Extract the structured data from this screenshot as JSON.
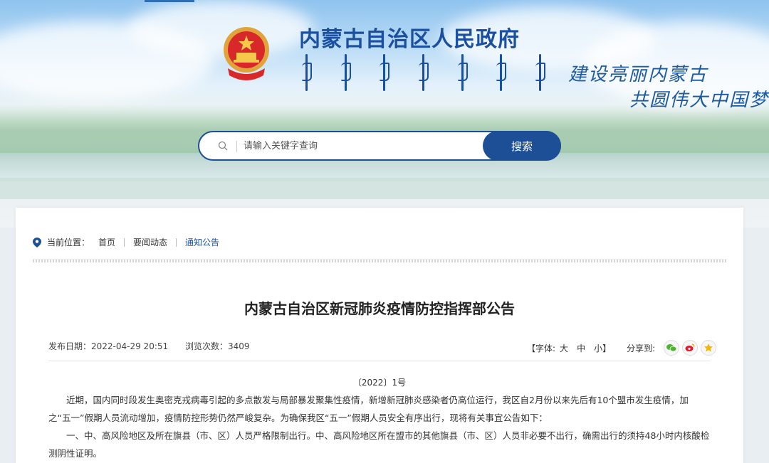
{
  "header": {
    "site_title": "内蒙古自治区人民政府",
    "slogan_line1": "建设亮丽内蒙古",
    "slogan_line2": "共圆伟大中国梦"
  },
  "search": {
    "placeholder": "请输入关键字查询",
    "button_label": "搜索"
  },
  "breadcrumb": {
    "label": "当前位置：",
    "items": [
      "首页",
      "要闻动态",
      "通知公告"
    ]
  },
  "article": {
    "title": "内蒙古自治区新冠肺炎疫情防控指挥部公告",
    "publish_date": "发布日期：2022-04-29 20:51",
    "views": "浏览次数：3409",
    "font_label_open": "【字体:",
    "font_large": "大",
    "font_medium": "中",
    "font_small": "小】",
    "share_label": "分享到:",
    "doc_number": "〔2022〕1号",
    "paragraph1": "近期，国内同时段发生奥密克戎病毒引起的多点散发与局部暴发聚集性疫情，新增新冠肺炎感染者仍高位运行，我区自2月份以来先后有10个盟市发生疫情，加之“五一”假期人员流动增加，疫情防控形势仍然严峻复杂。为确保我区“五一”假期人员安全有序出行，现将有关事宜公告如下：",
    "paragraph2": "一、中、高风险地区及所在旗县（市、区）人员严格限制出行。中、高风险地区所在盟市的其他旗县（市、区）人员非必要不出行，确需出行的须持48小时内核酸检测阴性证明。"
  },
  "share_icons": [
    "wechat-icon",
    "weibo-icon",
    "favorite-icon"
  ],
  "colors": {
    "brand_blue": "#1c4f96",
    "title_blue": "#1b4fa0"
  }
}
